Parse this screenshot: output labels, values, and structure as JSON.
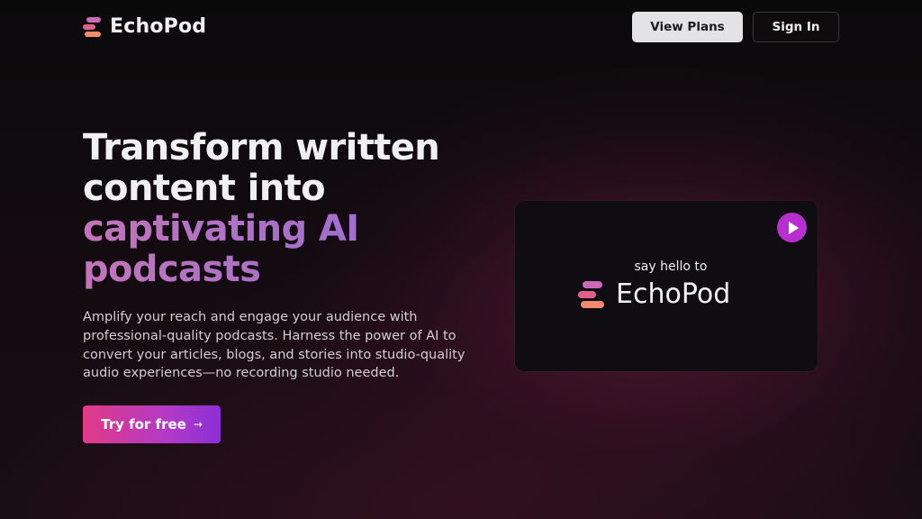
{
  "brand": {
    "name": "EchoPod",
    "logo_colors": [
      "#c96ab5",
      "#e0608a",
      "#f08b6e"
    ]
  },
  "nav": {
    "view_plans_label": "View Plans",
    "sign_in_label": "Sign In"
  },
  "hero": {
    "title_lines": [
      "Transform written",
      "content into"
    ],
    "title_highlight_lines": [
      "captivating AI",
      "podcasts"
    ],
    "description": "Amplify your reach and engage your audience with professional-quality podcasts. Harness the power of AI to convert your articles, blogs, and stories into studio-quality audio experiences—no recording studio needed.",
    "cta_label": "Try for free",
    "cta_arrow": "→"
  },
  "video": {
    "tagline": "say hello to",
    "brand_name": "EchoPod",
    "play_icon": "play-icon",
    "play_color": "#b82fcf"
  },
  "colors": {
    "accent_gradient_start": "#e13a87",
    "accent_gradient_end": "#8a2fd6",
    "highlight_text": "#a86fcc"
  }
}
